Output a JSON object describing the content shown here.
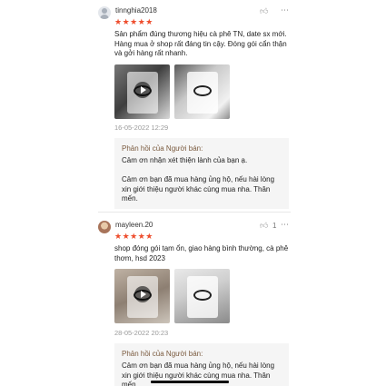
{
  "reviews": [
    {
      "username": "tinnghia2018",
      "stars": "★★★★★",
      "comment": "Sản phẩm đúng thương hiệu cà phê TN, date sx mới. Hàng mua ở shop rất đáng tin cậy. Đóng gói cẩn thận và gởi hàng rất nhanh.",
      "date": "16-05-2022 12:29",
      "like_count": "",
      "reply_title": "Phản hồi của Người bán:",
      "reply_text": "Cảm ơn nhận xét thiện lành của bạn ạ.\n\nCảm ơn bạn đã mua hàng ủng hộ, nếu hài lòng xin giới thiệu người khác cùng mua nha. Thân mến.",
      "media": [
        "video-thumbnail",
        "photo"
      ]
    },
    {
      "username": "mayleen.20",
      "stars": "★★★★★",
      "comment": "shop đóng gói tạm ổn, giao hàng bình thường, cà phê thơm, hsd 2023",
      "date": "28-05-2022 20:23",
      "like_count": "1",
      "reply_title": "Phản hồi của Người bán:",
      "reply_text": "Cảm ơn bạn đã mua hàng ủng hộ, nếu hài lòng xin giới thiệu người khác cùng mua nha. Thân mến.",
      "media": [
        "video-thumbnail",
        "photo"
      ]
    }
  ],
  "icons": {
    "like": "thumbs-up-icon",
    "more": "more-options-icon",
    "play": "play-icon"
  },
  "colors": {
    "star": "#ee4d2d",
    "seller_label": "#7a5a3e",
    "reply_bg": "#f5f5f5"
  }
}
